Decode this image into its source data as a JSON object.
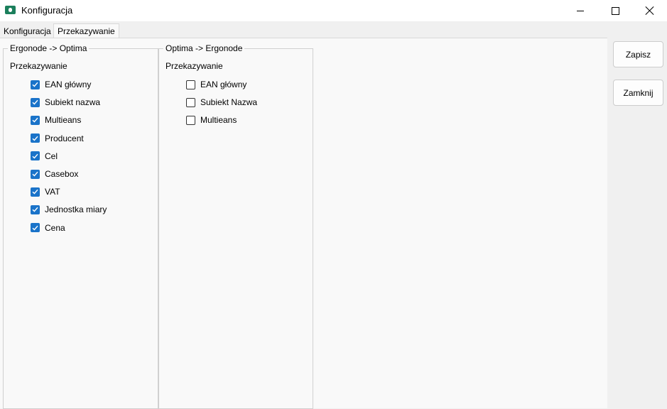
{
  "window": {
    "title": "Konfiguracja",
    "icons": {
      "app": "app-icon",
      "minimize": "minimize-icon",
      "maximize": "maximize-icon",
      "close": "close-icon"
    }
  },
  "tabs": [
    {
      "label": "Konfiguracja",
      "active": false
    },
    {
      "label": "Przekazywanie",
      "active": true
    }
  ],
  "left_group": {
    "title": "Ergonode -> Optima",
    "section": "Przekazywanie",
    "items": [
      {
        "label": "EAN główny",
        "checked": true
      },
      {
        "label": "Subiekt nazwa",
        "checked": true
      },
      {
        "label": "Multieans",
        "checked": true
      },
      {
        "label": "Producent",
        "checked": true
      },
      {
        "label": "Cel",
        "checked": true
      },
      {
        "label": "Casebox",
        "checked": true
      },
      {
        "label": "VAT",
        "checked": true
      },
      {
        "label": "Jednostka miary",
        "checked": true
      },
      {
        "label": "Cena",
        "checked": true
      }
    ]
  },
  "right_group": {
    "title": "Optima -> Ergonode",
    "section": "Przekazywanie",
    "items": [
      {
        "label": "EAN główny",
        "checked": false
      },
      {
        "label": "Subiekt Nazwa",
        "checked": false
      },
      {
        "label": "Multieans",
        "checked": false
      }
    ]
  },
  "buttons": {
    "save": "Zapisz",
    "close": "Zamknij"
  },
  "colors": {
    "checkbox_checked": "#1a73c9",
    "window_bg": "#f0f0f0",
    "panel_bg": "#f9f9f9"
  }
}
